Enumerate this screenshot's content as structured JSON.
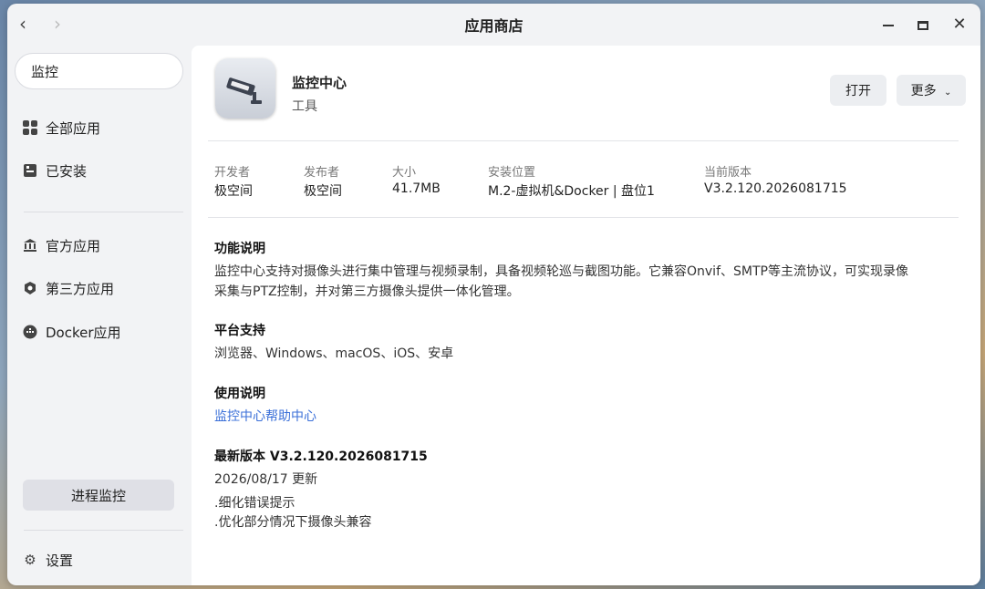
{
  "window": {
    "title": "应用商店"
  },
  "search": {
    "value": "监控"
  },
  "sidebar": {
    "items": [
      {
        "label": "全部应用",
        "icon": "grid-icon"
      },
      {
        "label": "已安装",
        "icon": "installed-icon"
      },
      {
        "label": "官方应用",
        "icon": "bank-icon"
      },
      {
        "label": "第三方应用",
        "icon": "third-party-icon"
      },
      {
        "label": "Docker应用",
        "icon": "docker-icon"
      }
    ],
    "process_button": "进程监控",
    "settings_label": "设置"
  },
  "app": {
    "name": "监控中心",
    "category": "工具",
    "open_label": "打开",
    "more_label": "更多"
  },
  "meta": {
    "developer_label": "开发者",
    "developer": "极空间",
    "publisher_label": "发布者",
    "publisher": "极空间",
    "size_label": "大小",
    "size": "41.7MB",
    "location_label": "安装位置",
    "location": "M.2-虚拟机&Docker | 盘位1",
    "version_label": "当前版本",
    "version": "V3.2.120.2026081715"
  },
  "sections": {
    "feature_title": "功能说明",
    "feature_line1": "监控中心支持对摄像头进行集中管理与视频录制，具备视频轮巡与截图功能。它兼容Onvif、SMTP等主流协议，可实现录像",
    "feature_line2": "采集与PTZ控制，并对第三方摄像头提供一体化管理。",
    "platform_title": "平台支持",
    "platform_text": "浏览器、Windows、macOS、iOS、安卓",
    "usage_title": "使用说明",
    "usage_link": "监控中心帮助中心",
    "latest_title": "最新版本 V3.2.120.2026081715",
    "latest_date": "2026/08/17 更新",
    "change1": ".细化错误提示",
    "change2": ".优化部分情况下摄像头兼容"
  }
}
